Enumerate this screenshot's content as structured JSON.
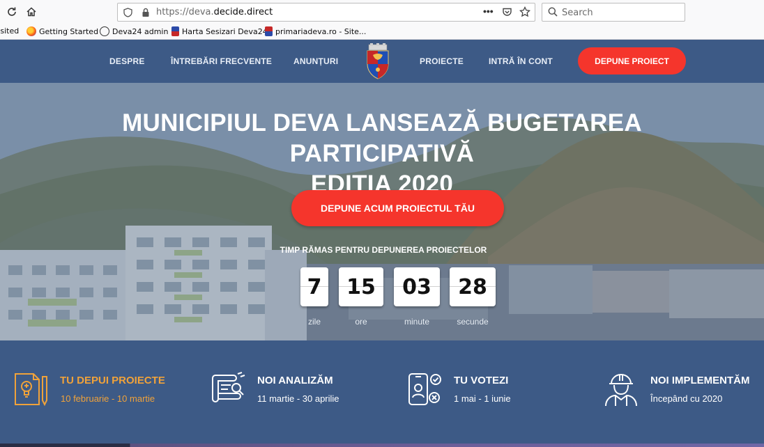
{
  "browser": {
    "url_prefix": "https://deva.",
    "url_domain": "decide.direct",
    "search_placeholder": "Search",
    "bookmarks": [
      {
        "label": "Visited"
      },
      {
        "label": "Getting Started"
      },
      {
        "label": "Deva24 admin"
      },
      {
        "label": "Harta Sesizari Deva24"
      },
      {
        "label": "primariadeva.ro - Site..."
      }
    ]
  },
  "nav": {
    "items": [
      "DESPRE",
      "ÎNTREBĂRI FRECVENTE",
      "ANUNȚURI",
      "PROIECTE",
      "INTRĂ ÎN CONT"
    ],
    "cta": "DEPUNE PROIECT"
  },
  "hero": {
    "title_line1": "MUNICIPIUL DEVA LANSEAZĂ BUGETAREA PARTICIPATIVĂ",
    "title_line2": "EDIȚIA 2020",
    "cta": "DEPUNE ACUM PROIECTUL TĂU",
    "countdown_label": "TIMP RĂMAS PENTRU DEPUNEREA PROIECTELOR",
    "countdown": [
      {
        "value": "7",
        "unit": "zile"
      },
      {
        "value": "15",
        "unit": "ore"
      },
      {
        "value": "03",
        "unit": "minute"
      },
      {
        "value": "28",
        "unit": "secunde"
      }
    ]
  },
  "steps": [
    {
      "title": "TU DEPUI PROIECTE",
      "date": "10 februarie - 10 martie",
      "icon": "lightbulb-document-icon",
      "active": true
    },
    {
      "title": "NOI ANALIZĂM",
      "date": "11 martie - 30 aprilie",
      "icon": "analysis-scroll-icon",
      "active": false
    },
    {
      "title": "TU VOTEZI",
      "date": "1 mai - 1 iunie",
      "icon": "phone-vote-icon",
      "active": false
    },
    {
      "title": "NOI IMPLEMENTĂM",
      "date": "Începând cu 2020",
      "icon": "worker-helmet-icon",
      "active": false
    }
  ],
  "colors": {
    "nav_bg": "#3d5a86",
    "cta_red": "#f5352c",
    "active_orange": "#f0a23a"
  }
}
